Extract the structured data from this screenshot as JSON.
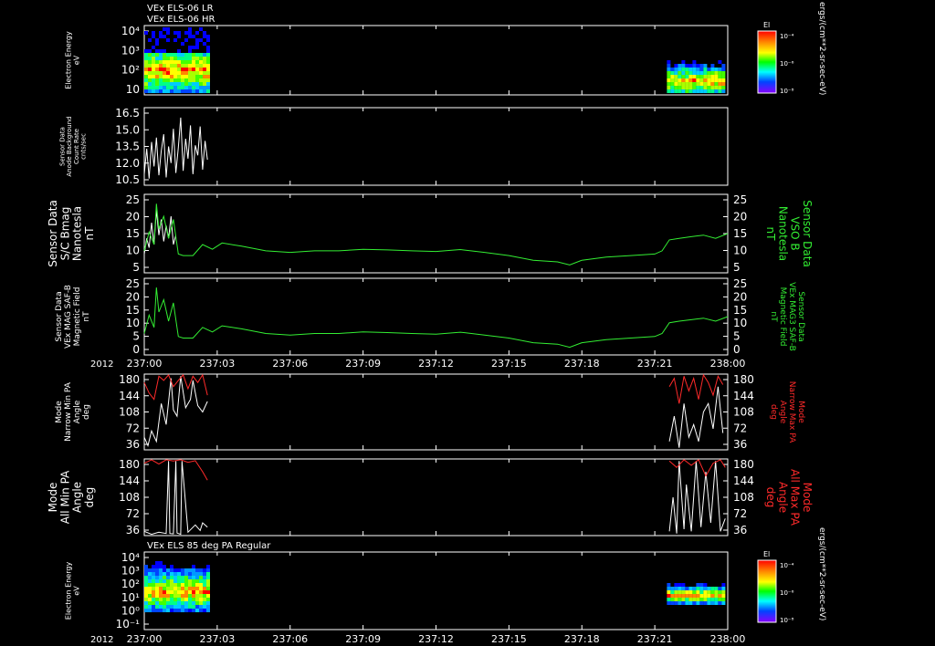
{
  "colors": {
    "background": "#000000",
    "axis": "#ffffff",
    "white_trace": "#ffffff",
    "green_trace": "#33ee33",
    "red_trace": "#ff2a2a"
  },
  "header": {
    "line1": "VEx ELS-06 LR",
    "line2": "VEx ELS-06 HR"
  },
  "x_axis": {
    "year_label": "2012",
    "ticks": [
      "237:00",
      "237:03",
      "237:06",
      "237:09",
      "237:12",
      "237:15",
      "237:18",
      "237:21",
      "238:00"
    ],
    "range_minutes": [
      0,
      24
    ]
  },
  "colorbars": [
    {
      "title": "El",
      "ticks": [
        "10⁻⁴",
        "10⁻⁶",
        "10⁻⁸"
      ]
    },
    {
      "title": "El",
      "ticks": [
        "10⁻⁴",
        "10⁻⁶",
        "10⁻⁸"
      ]
    }
  ],
  "colorbar_unit": "ergs/(cm**2-sr-sec-eV)",
  "chart_data": [
    {
      "type": "heatmap",
      "panel": "electron-energy-spectrogram-1",
      "ylabel": [
        "Electron Energy",
        "eV"
      ],
      "yscale": "log",
      "ytick_labels": [
        "10⁴",
        "10³",
        "10²",
        "10"
      ],
      "ylim": [
        3,
        15000
      ],
      "data_intervals_minutes": [
        [
          0,
          2.6
        ],
        [
          21.5,
          23.9
        ]
      ]
    },
    {
      "type": "line",
      "panel": "anode-background-count-rate",
      "ylabel": [
        "Sensor Data",
        "Anode Background",
        "Count Rate",
        "cnts/sec"
      ],
      "ytick_labels": [
        "16.5",
        "15.0",
        "13.5",
        "12.0",
        "10.5"
      ],
      "ylim": [
        9.5,
        16.5
      ],
      "series": [
        {
          "color": "#ffffff",
          "x": [
            0.0,
            0.1,
            0.2,
            0.3,
            0.4,
            0.5,
            0.6,
            0.7,
            0.8,
            0.9,
            1.0,
            1.1,
            1.2,
            1.3,
            1.4,
            1.5,
            1.6,
            1.7,
            1.8,
            1.9,
            2.0,
            2.1,
            2.2,
            2.3,
            2.4,
            2.5,
            2.6
          ],
          "y": [
            10.5,
            12.8,
            10.1,
            13.4,
            11.2,
            13.8,
            10.4,
            12.6,
            14.1,
            10.2,
            13.0,
            11.5,
            14.6,
            10.6,
            12.9,
            15.6,
            10.8,
            13.7,
            11.9,
            14.9,
            10.5,
            13.1,
            12.2,
            14.8,
            10.9,
            13.5,
            11.8
          ]
        }
      ]
    },
    {
      "type": "line",
      "panel": "sc-bmag-vso",
      "ylabel_left": [
        "Sensor Data",
        "S/C Bmag",
        "Nanotesla",
        "nT"
      ],
      "ylabel_right": [
        "Sensor Data",
        "VSO B",
        "Nanotesla",
        "nT"
      ],
      "ytick_labels": [
        "25",
        "20",
        "15",
        "10",
        "5"
      ],
      "ylim": [
        0,
        25
      ],
      "series": [
        {
          "color": "#ffffff",
          "x": [
            0.0,
            0.1,
            0.2,
            0.3,
            0.4,
            0.5,
            0.6,
            0.7,
            0.8,
            0.9,
            1.0,
            1.1,
            1.2,
            1.3
          ],
          "y": [
            6,
            11,
            8,
            16,
            9,
            20,
            12,
            17,
            10,
            15,
            11,
            18,
            9,
            12
          ]
        },
        {
          "color": "#33ee33",
          "x": [
            0.0,
            0.2,
            0.4,
            0.5,
            0.6,
            0.8,
            1.0,
            1.2,
            1.4,
            1.6,
            2.0,
            2.4,
            2.8,
            3.2,
            4.0,
            5.0,
            6.0,
            7.0,
            8.0,
            9.0,
            10.0,
            11.0,
            12.0,
            13.0,
            14.0,
            15.0,
            16.0,
            17.0,
            17.5,
            18.0,
            19.0,
            20.0,
            21.0,
            21.3,
            21.6,
            22.0,
            22.5,
            23.0,
            23.5,
            24.0
          ],
          "y": [
            7,
            13,
            9,
            22,
            14,
            18,
            11,
            17,
            6,
            5.5,
            5.5,
            9,
            7.5,
            9.5,
            8.5,
            7,
            6.5,
            7,
            7,
            7.5,
            7.3,
            7,
            6.8,
            7.4,
            6.5,
            5.5,
            4,
            3.5,
            2.5,
            4,
            5,
            5.5,
            6,
            7,
            10.5,
            11,
            11.5,
            12,
            11,
            12.5
          ]
        }
      ]
    },
    {
      "type": "line",
      "panel": "magnetic-field",
      "ylabel_left": [
        "Sensor Data",
        "VEx MAG SAF-B",
        "Magnetic Field",
        "nT"
      ],
      "ylabel_right": [
        "Sensor Data",
        "VEx MAG3 SAF-B",
        "Magnetic Field",
        "nT"
      ],
      "ytick_labels": [
        "25",
        "20",
        "15",
        "10",
        "5",
        "0"
      ],
      "ylim": [
        0,
        25
      ],
      "series": [
        {
          "color": "#33ee33",
          "x": [
            0.0,
            0.2,
            0.4,
            0.5,
            0.6,
            0.8,
            1.0,
            1.2,
            1.4,
            1.6,
            2.0,
            2.4,
            2.8,
            3.2,
            4.0,
            5.0,
            6.0,
            7.0,
            8.0,
            9.0,
            10.0,
            11.0,
            12.0,
            13.0,
            14.0,
            15.0,
            16.0,
            17.0,
            17.5,
            18.0,
            19.0,
            20.0,
            21.0,
            21.3,
            21.6,
            22.0,
            22.5,
            23.0,
            23.5,
            24.0
          ],
          "y": [
            7,
            13,
            9,
            22,
            14,
            18,
            11,
            17,
            6,
            5.5,
            5.5,
            9,
            7.5,
            9.5,
            8.5,
            7,
            6.5,
            7,
            7,
            7.5,
            7.3,
            7,
            6.8,
            7.4,
            6.5,
            5.5,
            4,
            3.5,
            2.5,
            4,
            5,
            5.5,
            6,
            7,
            10.5,
            11,
            11.5,
            12,
            11,
            12.5
          ]
        }
      ]
    },
    {
      "type": "line",
      "panel": "narrow-pa-angle",
      "ylabel_left": [
        "Mode",
        "Narrow Min PA",
        "Angle",
        "deg"
      ],
      "ylabel_right": [
        "Mode",
        "Narrow Max PA",
        "Angle",
        "deg"
      ],
      "ytick_labels": [
        "180",
        "144",
        "108",
        "72",
        "36"
      ],
      "ylim": [
        0,
        180
      ],
      "series": [
        {
          "color": "#ffffff",
          "x": [
            0.0,
            0.15,
            0.3,
            0.5,
            0.7,
            0.9,
            1.1,
            1.2,
            1.35,
            1.5,
            1.7,
            1.9,
            2.0,
            2.2,
            2.4,
            2.6,
            21.6,
            21.8,
            22.0,
            22.2,
            22.4,
            22.6,
            22.8,
            23.0,
            23.2,
            23.4,
            23.6,
            23.8
          ],
          "y": [
            30,
            10,
            45,
            20,
            110,
            60,
            170,
            95,
            80,
            175,
            100,
            120,
            165,
            105,
            90,
            115,
            20,
            80,
            5,
            110,
            30,
            60,
            20,
            90,
            110,
            50,
            150,
            40
          ]
        },
        {
          "color": "#ff2a2a",
          "x": [
            0.0,
            0.2,
            0.4,
            0.6,
            0.8,
            1.0,
            1.2,
            1.4,
            1.6,
            1.8,
            2.0,
            2.2,
            2.4,
            2.6,
            21.6,
            21.8,
            22.0,
            22.2,
            22.4,
            22.6,
            22.8,
            23.0,
            23.2,
            23.4,
            23.6,
            23.8
          ],
          "y": [
            160,
            135,
            120,
            175,
            165,
            178,
            150,
            165,
            178,
            145,
            175,
            160,
            178,
            130,
            150,
            170,
            110,
            175,
            140,
            170,
            120,
            178,
            160,
            130,
            175,
            155
          ]
        }
      ]
    },
    {
      "type": "line",
      "panel": "all-pa-angle",
      "ylabel_left": [
        "Mode",
        "All Min PA",
        "Angle",
        "deg"
      ],
      "ylabel_right": [
        "Mode",
        "All Max PA",
        "Angle",
        "deg"
      ],
      "ytick_labels": [
        "180",
        "144",
        "108",
        "72",
        "36"
      ],
      "ylim": [
        0,
        180
      ],
      "series": [
        {
          "color": "#ffffff",
          "x": [
            0.0,
            0.3,
            0.6,
            0.9,
            1.0,
            1.05,
            1.2,
            1.3,
            1.35,
            1.5,
            1.55,
            1.8,
            2.1,
            2.3,
            2.4,
            2.6,
            21.6,
            21.75,
            21.9,
            22.0,
            22.2,
            22.3,
            22.5,
            22.7,
            22.9,
            23.1,
            23.3,
            23.5,
            23.7,
            23.9
          ],
          "y": [
            10,
            3,
            8,
            5,
            175,
            5,
            4,
            175,
            6,
            3,
            175,
            8,
            25,
            12,
            30,
            20,
            10,
            90,
            5,
            175,
            15,
            120,
            10,
            175,
            20,
            150,
            30,
            175,
            10,
            40
          ]
        },
        {
          "color": "#ff2a2a",
          "x": [
            0.0,
            0.3,
            0.6,
            0.9,
            1.2,
            1.5,
            1.8,
            2.1,
            2.4,
            2.6,
            21.6,
            21.9,
            22.2,
            22.5,
            22.8,
            23.1,
            23.4,
            23.7,
            23.9
          ],
          "y": [
            170,
            178,
            168,
            178,
            175,
            178,
            172,
            176,
            150,
            130,
            175,
            160,
            178,
            165,
            178,
            140,
            170,
            178,
            160
          ]
        }
      ]
    },
    {
      "type": "heatmap",
      "panel": "electron-energy-spectrogram-2",
      "title": "VEx ELS 85 deg PA Regular",
      "ylabel": [
        "Electron Energy",
        "eV"
      ],
      "yscale": "log",
      "ytick_labels": [
        "10⁴",
        "10³",
        "10²",
        "10¹",
        "10⁰",
        "10⁻¹"
      ],
      "ylim": [
        0.1,
        15000
      ],
      "data_intervals_minutes": [
        [
          0,
          2.6
        ],
        [
          21.5,
          23.9
        ]
      ]
    }
  ]
}
